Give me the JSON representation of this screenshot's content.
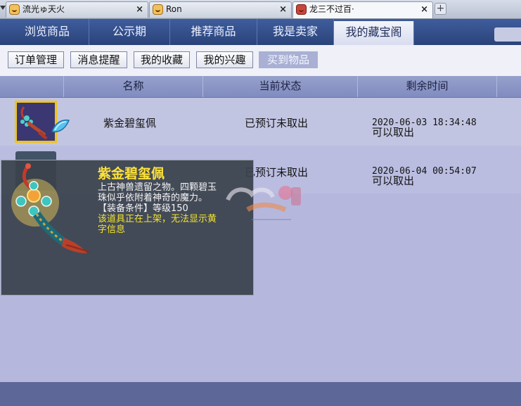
{
  "browser_tabs": [
    {
      "title": "流光ゅ天火",
      "icon": "game-favicon",
      "close": "×"
    },
    {
      "title": "Ron",
      "icon": "game-favicon",
      "close": "×"
    },
    {
      "title": "龙三不过百·",
      "icon": "dragon-favicon",
      "close": "×"
    }
  ],
  "new_tab_glyph": "+",
  "main_nav": [
    "浏览商品",
    "公示期",
    "推荐商品",
    "我是卖家",
    "我的藏宝阁"
  ],
  "main_nav_active": "我的藏宝阁",
  "sub_nav": [
    "订单管理",
    "消息提醒",
    "我的收藏",
    "我的兴趣",
    "买到物品"
  ],
  "sub_nav_active": "买到物品",
  "table": {
    "headers": [
      "名称",
      "当前状态",
      "剩余时间"
    ],
    "rows": [
      {
        "name": "紫金碧玺佩",
        "status": "已预订未取出",
        "time": "2020-06-03 18:34:48",
        "time_note": "可以取出"
      },
      {
        "name": "",
        "status": "已预订未取出",
        "time": "2020-06-04 00:54:07",
        "time_note": "可以取出"
      }
    ]
  },
  "tooltip": {
    "name": "紫金碧玺佩",
    "desc_1": "上古神兽遗留之物。四颗碧玉",
    "desc_2": "珠似乎依附着神奇的魔力。",
    "equip_req": "【装备条件】等级150",
    "warning_1": "该道具正在上架，无法显示黄",
    "warning_2": "字信息"
  },
  "colors": {
    "nav_bg": "#2f4a86",
    "active_tab_text": "#1e2d5a",
    "tooltip_name": "#ffe23a",
    "tooltip_warning": "#f3e32c",
    "thumb_border": "#f0c419"
  }
}
